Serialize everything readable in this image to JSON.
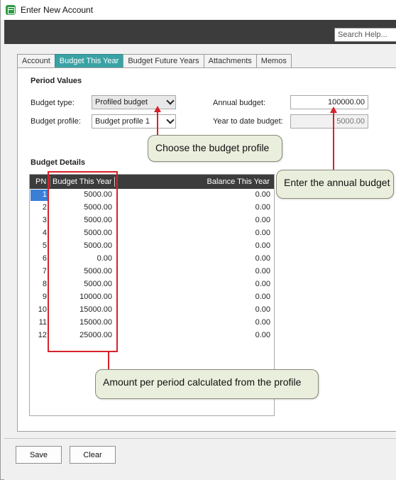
{
  "window": {
    "title": "Enter New Account"
  },
  "search": {
    "placeholder": "Search Help..."
  },
  "tabs": [
    {
      "label": "Account"
    },
    {
      "label": "Budget This Year"
    },
    {
      "label": "Budget Future Years"
    },
    {
      "label": "Attachments"
    },
    {
      "label": "Memos"
    }
  ],
  "period_values": {
    "title": "Period Values",
    "budget_type_label": "Budget type:",
    "budget_type_value": "Profiled budget",
    "budget_profile_label": "Budget profile:",
    "budget_profile_value": "Budget profile 1",
    "annual_budget_label": "Annual budget:",
    "annual_budget_value": "100000.00",
    "ytd_budget_label": "Year to date budget:",
    "ytd_budget_value": "5000.00"
  },
  "budget_details": {
    "title": "Budget Details",
    "headers": {
      "pn": "PN",
      "budget": "Budget This Year",
      "balance": "Balance This Year"
    },
    "rows": [
      {
        "pn": "1",
        "budget": "5000.00",
        "balance": "0.00"
      },
      {
        "pn": "2",
        "budget": "5000.00",
        "balance": "0.00"
      },
      {
        "pn": "3",
        "budget": "5000.00",
        "balance": "0.00"
      },
      {
        "pn": "4",
        "budget": "5000.00",
        "balance": "0.00"
      },
      {
        "pn": "5",
        "budget": "5000.00",
        "balance": "0.00"
      },
      {
        "pn": "6",
        "budget": "0.00",
        "balance": "0.00"
      },
      {
        "pn": "7",
        "budget": "5000.00",
        "balance": "0.00"
      },
      {
        "pn": "8",
        "budget": "5000.00",
        "balance": "0.00"
      },
      {
        "pn": "9",
        "budget": "10000.00",
        "balance": "0.00"
      },
      {
        "pn": "10",
        "budget": "15000.00",
        "balance": "0.00"
      },
      {
        "pn": "11",
        "budget": "15000.00",
        "balance": "0.00"
      },
      {
        "pn": "12",
        "budget": "25000.00",
        "balance": "0.00"
      }
    ]
  },
  "callouts": {
    "profile": "Choose the budget profile",
    "annual": "Enter the annual budget",
    "amount": "Amount per period calculated from the profile"
  },
  "buttons": {
    "save": "Save",
    "clear": "Clear"
  },
  "colors": {
    "active_tab": "#3aa2a5",
    "header_bar": "#3c3c3c",
    "annotation_red": "#d8222a",
    "callout_bg": "#eaeedc",
    "selection": "#3a7fd5"
  }
}
